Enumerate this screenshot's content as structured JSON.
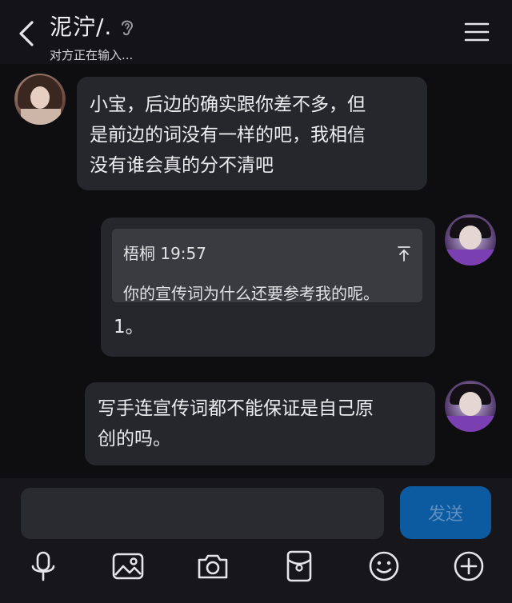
{
  "header": {
    "title": "泥泞/.",
    "status": "对方正在输入..."
  },
  "messages": [
    {
      "side": "left",
      "text_lines": [
        "小宝，后边的确实跟你差不多，但",
        "是前边的词没有一样的吧，我相信",
        "没有谁会真的分不清吧"
      ]
    },
    {
      "side": "right",
      "quote": {
        "author_time": "梧桐 19:57",
        "text": "你的宣传词为什么还要参考我的呢。"
      },
      "text": "1。"
    },
    {
      "side": "right",
      "text_lines": [
        "写手连宣传词都不能保证是自己原",
        "创的吗。"
      ]
    }
  ],
  "composer": {
    "send_label": "发送"
  },
  "toolbar": {
    "icons": [
      "microphone-icon",
      "image-icon",
      "camera-icon",
      "red-packet-icon",
      "emoji-icon",
      "plus-icon"
    ]
  },
  "colors": {
    "background": "#0e0e10",
    "bubble": "#26272c",
    "quote": "#3a3b40",
    "send_button": "#0c5aa0"
  }
}
